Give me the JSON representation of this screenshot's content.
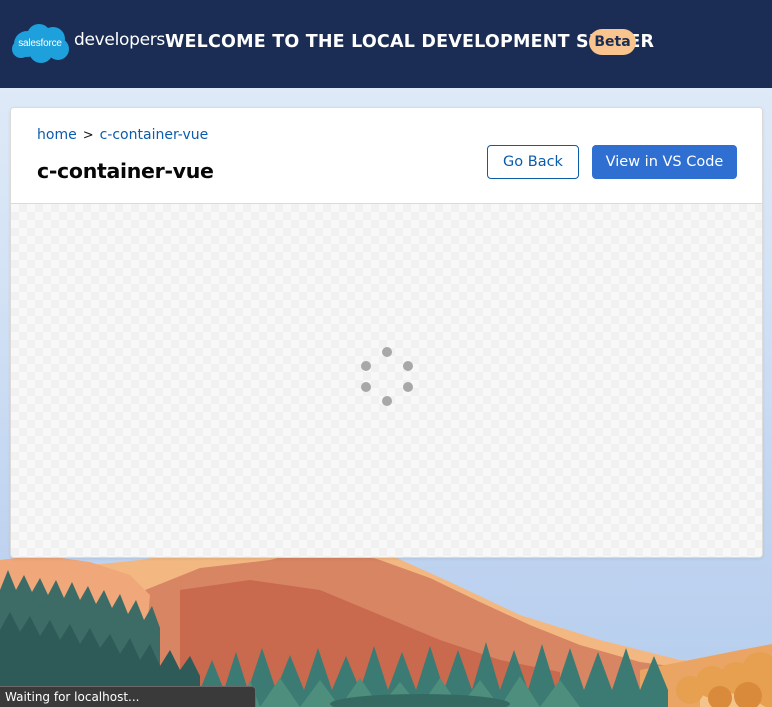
{
  "header": {
    "logo_text": "salesforce",
    "product": "developers",
    "welcome": "WELCOME TO THE LOCAL DEVELOPMENT SERVER",
    "badge": "Beta",
    "bg_color": "#1b2d54",
    "badge_color": "#f9c48e"
  },
  "breadcrumb": {
    "home": "home",
    "separator": ">",
    "current": "c-container-vue"
  },
  "page": {
    "title": "c-container-vue"
  },
  "actions": {
    "go_back": "Go Back",
    "view_in_vscode": "View in VS Code",
    "primary_color": "#2e6fd1"
  },
  "content": {
    "loading_indicator": "spinner-icon"
  },
  "statusbar": {
    "text": "Waiting for localhost..."
  }
}
